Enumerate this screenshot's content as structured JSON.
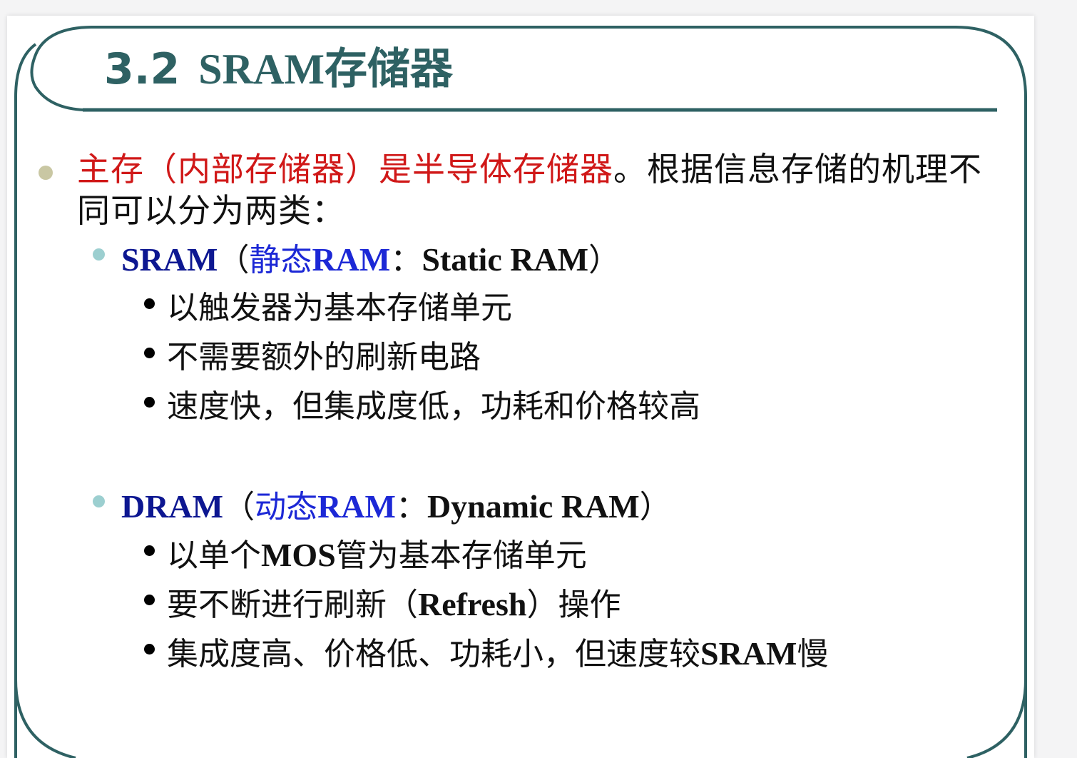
{
  "slide": {
    "title_number": "3.2",
    "title_text": "SRAM存储器",
    "intro": {
      "highlight": "主存（内部存储器）是半导体存储器",
      "rest": "。根据信息存储的机理不同可以分为两类："
    },
    "sram": {
      "abbr": "SRAM",
      "open": "（",
      "cn": "静态",
      "ram": "RAM",
      "colon": "：",
      "full": "Static RAM",
      "close": "）",
      "points": [
        "以触发器为基本存储单元",
        "不需要额外的刷新电路",
        "速度快，但集成度低，功耗和价格较高"
      ]
    },
    "dram": {
      "abbr": "DRAM",
      "open": "（",
      "cn": "动态",
      "ram": "RAM",
      "colon": "：",
      "full": "Dynamic RAM",
      "close": "）",
      "points": [
        {
          "a": "以单个",
          "en": "MOS",
          "b": "管为基本存储单元"
        },
        {
          "a": "要不断进行刷新（",
          "en": "Refresh",
          "b": "）操作"
        },
        {
          "a": "集成度高、价格低、功耗小，但速度较",
          "en": "SRAM",
          "b": "慢"
        }
      ]
    }
  },
  "colors": {
    "frame": "#2e6163",
    "title": "#2e6163",
    "highlight_red": "#d01818",
    "term_navy": "#0d1791",
    "term_blue": "#1c28d6",
    "bullet_level1": "#c9c7a3",
    "bullet_level2": "#9ccfd0",
    "bullet_level3": "#000000"
  },
  "icons": [
    "bullet-dot-icon"
  ]
}
